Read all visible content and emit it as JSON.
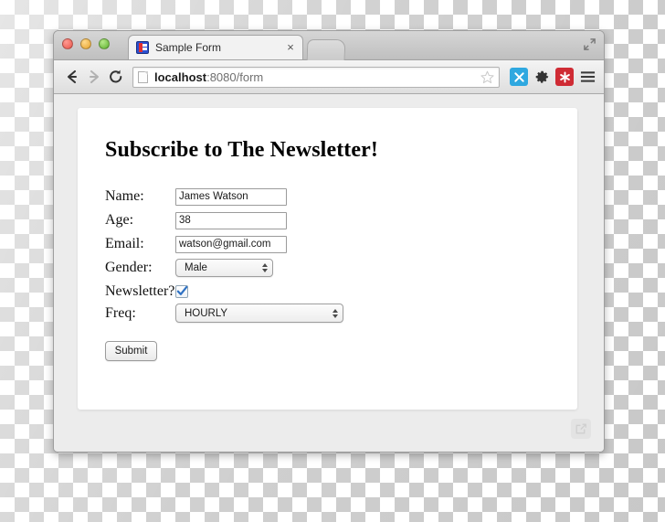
{
  "window": {
    "traffic_lights": [
      "close",
      "minimize",
      "maximize"
    ],
    "fullscreen_icon": "fullscreen-icon"
  },
  "tabstrip": {
    "tab": {
      "favicon": "site-favicon",
      "title": "Sample Form",
      "close_label": "×"
    },
    "new_tab_label": ""
  },
  "toolbar": {
    "back_icon": "back-arrow-icon",
    "forward_icon": "forward-arrow-icon",
    "reload_icon": "reload-icon",
    "page_icon": "page-document-icon",
    "url_host": "localhost",
    "url_rest": ":8080/form",
    "url_full": "localhost:8080/form",
    "star_icon": "bookmark-star-icon",
    "extensions": [
      {
        "name": "extension-blue-icon",
        "glyph": "✕",
        "color": "#2fa8e0"
      },
      {
        "name": "gear-icon",
        "glyph": "⚙",
        "color": "#3a3a3a"
      },
      {
        "name": "extension-red-icon",
        "glyph": "✱",
        "color": "#cf2b34"
      },
      {
        "name": "menu-hamburger-icon",
        "glyph": "☰",
        "color": "#3a3a3a"
      }
    ]
  },
  "page": {
    "title": "Subscribe to The Newsletter!",
    "fields": {
      "name": {
        "label": "Name:",
        "value": "James Watson",
        "placeholder": ""
      },
      "age": {
        "label": "Age:",
        "value": "38",
        "placeholder": ""
      },
      "email": {
        "label": "Email:",
        "value": "watson@gmail.com",
        "placeholder": ""
      },
      "gender": {
        "label": "Gender:",
        "selected": "Male"
      },
      "newsletter": {
        "label": "Newsletter?",
        "checked": true
      },
      "freq": {
        "label": "Freq:",
        "selected": "HOURLY"
      }
    },
    "submit_label": "Submit",
    "share_icon": "share-export-icon"
  }
}
